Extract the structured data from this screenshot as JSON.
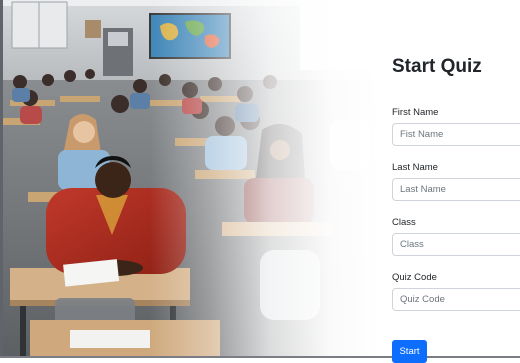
{
  "form": {
    "title": "Start Quiz",
    "fields": [
      {
        "label": "First Name",
        "placeholder": "Fist Name"
      },
      {
        "label": "Last Name",
        "placeholder": "Last Name"
      },
      {
        "label": "Class",
        "placeholder": "Class"
      },
      {
        "label": "Quiz Code",
        "placeholder": "Quiz Code"
      }
    ],
    "submit_label": "Start"
  },
  "colors": {
    "primary": "#0d6efd",
    "input_border": "#ced4da",
    "placeholder": "#6c757d",
    "text": "#212529"
  }
}
